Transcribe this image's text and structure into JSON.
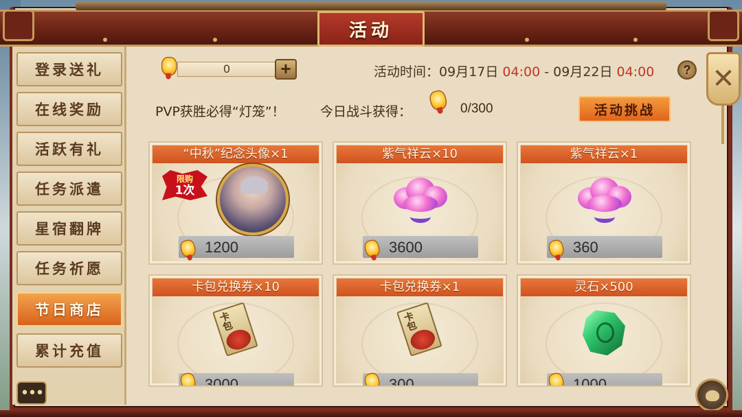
{
  "window": {
    "title": "活动"
  },
  "sidebar": {
    "items": [
      {
        "label": "登录送礼",
        "active": false
      },
      {
        "label": "在线奖励",
        "active": false
      },
      {
        "label": "活跃有礼",
        "active": false
      },
      {
        "label": "任务派遣",
        "active": false
      },
      {
        "label": "星宿翻牌",
        "active": false
      },
      {
        "label": "任务祈愿",
        "active": false
      },
      {
        "label": "节日商店",
        "active": true
      },
      {
        "label": "累计充值",
        "active": false
      }
    ],
    "menu_icon": "ellipsis-icon"
  },
  "currency": {
    "value": "0",
    "icon": "lantern-icon",
    "add_label": "+"
  },
  "event_time": {
    "label": "活动时间：",
    "start_date": "09月17日",
    "start_time": "04:00",
    "separator": "-",
    "end_date": "09月22日",
    "end_time": "04:00",
    "help_label": "?"
  },
  "pvp": {
    "text": "PVP获胜必得“灯笼”！",
    "battle_label": "今日战斗获得：",
    "battle_count": "0/300",
    "challenge_button": "活动挑战"
  },
  "shop": {
    "items": [
      {
        "title": "“中秋”纪念头像×1",
        "price": "1200",
        "icon": "avatar-portrait-icon",
        "limit_badge_top": "限购",
        "limit_badge_bottom": "1次"
      },
      {
        "title": "紫气祥云×10",
        "price": "3600",
        "icon": "purple-cloud-icon"
      },
      {
        "title": "紫气祥云×1",
        "price": "360",
        "icon": "purple-cloud-icon"
      },
      {
        "title": "卡包兑换券×10",
        "price": "3000",
        "icon": "card-pack-voucher-icon",
        "pack_text": "卡包"
      },
      {
        "title": "卡包兑换券×1",
        "price": "300",
        "icon": "card-pack-voucher-icon",
        "pack_text": "卡包"
      },
      {
        "title": "灵石×500",
        "price": "1000",
        "icon": "spirit-stone-icon"
      }
    ]
  },
  "close_button": {
    "label": "✕"
  },
  "colors": {
    "accent": "#d8631c",
    "time_red": "#c23421",
    "frame": "#7a2c1e"
  }
}
